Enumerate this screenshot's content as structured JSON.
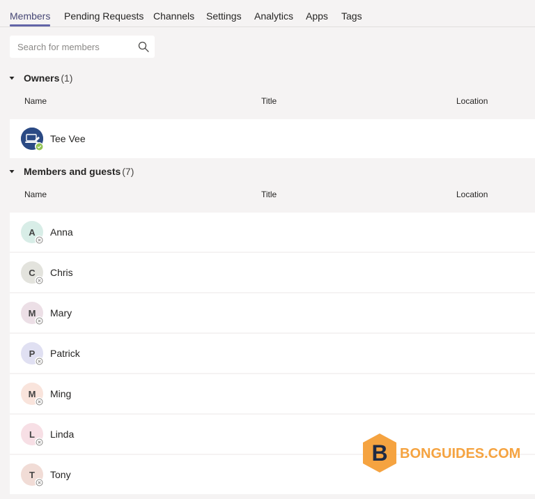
{
  "tabs": [
    {
      "label": "Members",
      "active": true
    },
    {
      "label": "Pending Requests"
    },
    {
      "label": "Channels"
    },
    {
      "label": "Settings"
    },
    {
      "label": "Analytics"
    },
    {
      "label": "Apps"
    },
    {
      "label": "Tags"
    }
  ],
  "search": {
    "placeholder": "Search for members",
    "icon": "search-icon"
  },
  "owners": {
    "title": "Owners",
    "count": "(1)",
    "columns": {
      "name": "Name",
      "title": "Title",
      "location": "Location"
    },
    "members": [
      {
        "name": "Tee Vee",
        "avatar": "device-avatar-icon",
        "status": "available",
        "status_color": "#92c353"
      }
    ]
  },
  "members_guests": {
    "title": "Members and guests",
    "count": "(7)",
    "columns": {
      "name": "Name",
      "title": "Title",
      "location": "Location"
    },
    "members": [
      {
        "name": "Anna",
        "initial": "A",
        "avatar_color": "#d8ede7",
        "status": "offline"
      },
      {
        "name": "Chris",
        "initial": "C",
        "avatar_color": "#e3e3dd",
        "status": "offline"
      },
      {
        "name": "Mary",
        "initial": "M",
        "avatar_color": "#ecdfe6",
        "status": "offline"
      },
      {
        "name": "Patrick",
        "initial": "P",
        "avatar_color": "#e0e0f2",
        "status": "offline"
      },
      {
        "name": "Ming",
        "initial": "M",
        "avatar_color": "#f9e4dc",
        "status": "offline"
      },
      {
        "name": "Linda",
        "initial": "L",
        "avatar_color": "#f7dfe5",
        "status": "offline"
      },
      {
        "name": "Tony",
        "initial": "T",
        "avatar_color": "#f1dcd6",
        "status": "offline"
      }
    ]
  },
  "watermark": {
    "text": "BONGUIDES.COM",
    "logo_letter": "B",
    "color": "#f5a340"
  }
}
